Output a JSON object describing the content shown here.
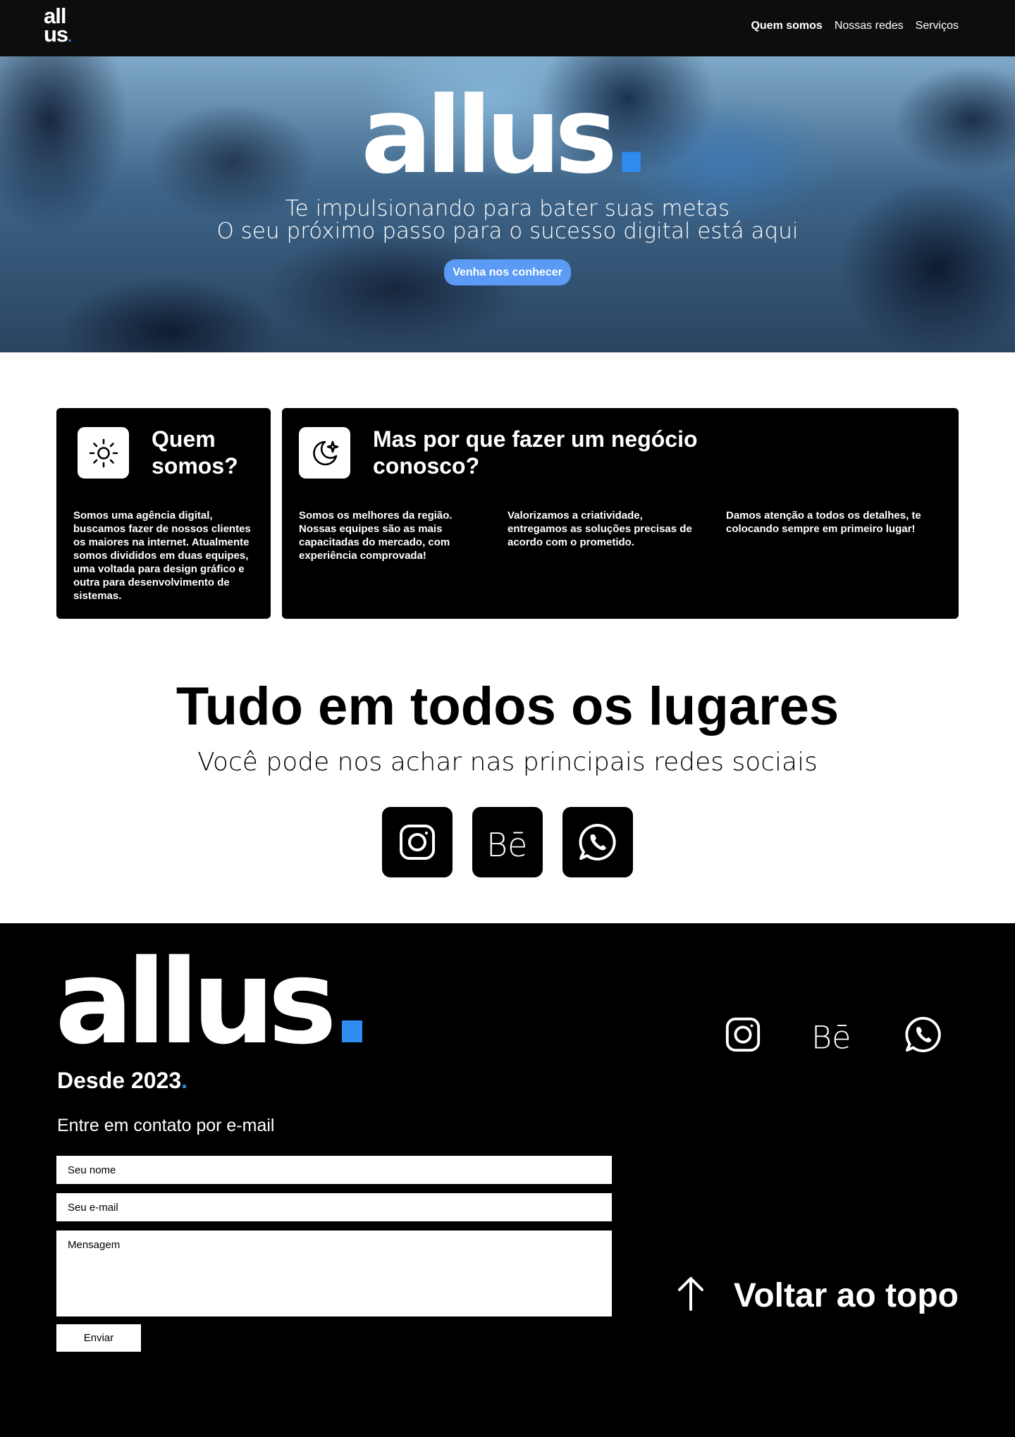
{
  "nav": {
    "logo_line1": "all",
    "logo_line2": "us",
    "logo_dot": ".",
    "links": [
      "Quem somos",
      "Nossas redes",
      "Serviços"
    ]
  },
  "hero": {
    "logo": "allus",
    "logo_dot": ".",
    "tagline1": "Te impulsionando para bater suas metas",
    "tagline2": "O seu próximo passo para o sucesso digital está aqui",
    "cta": "Venha nos conhecer",
    "cta_color": "#5b9bf6"
  },
  "about": {
    "quem": {
      "icon": "sun-icon",
      "title": "Quem somos?",
      "text": "Somos uma agência digital, buscamos fazer de nossos clientes os maiores na internet. Atualmente somos divididos em duas equipes, uma voltada para design gráfico e outra para desenvolvimento de sistemas."
    },
    "porque": {
      "icon": "moon-star-icon",
      "title": "Mas por que fazer um negócio conosco?",
      "items": [
        "Somos os melhores da região. Nossas equipes são as mais capacitadas do mercado, com experiência comprovada!",
        "Valorizamos a criatividade, entregamos as soluções precisas de acordo com o prometido.",
        "Damos atenção a todos os detalhes, te colocando sempre em primeiro lugar!"
      ]
    }
  },
  "social": {
    "title": "Tudo em todos os lugares",
    "subtitle": "Você pode nos achar nas principais redes sociais",
    "icons": [
      "instagram-icon",
      "behance-icon",
      "whatsapp-icon"
    ]
  },
  "footer": {
    "logo": "allus",
    "logo_dot": ".",
    "since": "Desde 2023",
    "since_dot": ".",
    "contact_label": "Entre em contato por e-mail",
    "form": {
      "name_placeholder": "Seu nome",
      "email_placeholder": "Seu e-mail",
      "message_placeholder": "Mensagem",
      "submit": "Enviar"
    },
    "back_to_top": "Voltar ao topo",
    "accent_color": "#2e8bf0"
  }
}
